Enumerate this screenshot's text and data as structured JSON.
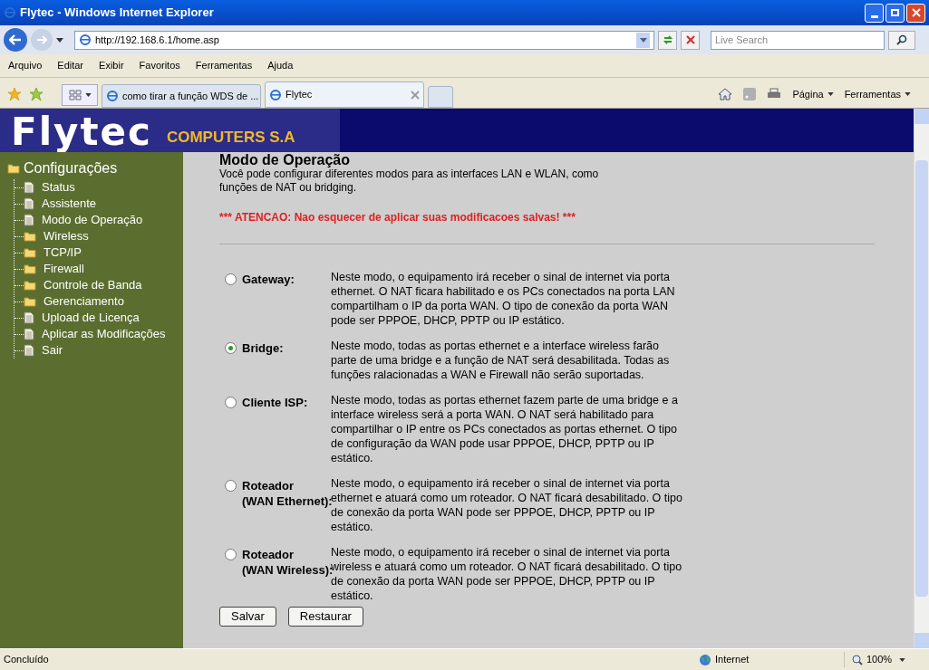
{
  "window": {
    "title": "Flytec - Windows Internet Explorer"
  },
  "address_bar": {
    "url": "http://192.168.6.1/home.asp"
  },
  "search": {
    "placeholder": "Live Search"
  },
  "menu": [
    "Arquivo",
    "Editar",
    "Exibir",
    "Favoritos",
    "Ferramentas",
    "Ajuda"
  ],
  "tabs": [
    {
      "label": "como tirar a função WDS de ...",
      "selected": false
    },
    {
      "label": "Flytec",
      "selected": true
    }
  ],
  "command_bar": [
    "Página",
    "Ferramentas"
  ],
  "header": {
    "logo": "Flytec",
    "subtitle": "COMPUTERS S.A"
  },
  "sidebar": {
    "root": "Configurações",
    "children": [
      {
        "label": "Status",
        "kind": "page"
      },
      {
        "label": "Assistente",
        "kind": "page"
      },
      {
        "label": "Modo de Operação",
        "kind": "page"
      },
      {
        "label": "Wireless",
        "kind": "folder"
      },
      {
        "label": "TCP/IP",
        "kind": "folder"
      },
      {
        "label": "Firewall",
        "kind": "folder"
      },
      {
        "label": "Controle de Banda",
        "kind": "folder"
      },
      {
        "label": "Gerenciamento",
        "kind": "folder"
      },
      {
        "label": "Upload de Licença",
        "kind": "page"
      },
      {
        "label": "Aplicar as Modificações",
        "kind": "page"
      },
      {
        "label": "Sair",
        "kind": "page"
      }
    ]
  },
  "content": {
    "title": "Modo de Operação",
    "intro": "Você pode configurar diferentes modos para as interfaces LAN e WLAN, como funções de NAT ou bridging.",
    "warning": "*** ATENCAO: Nao esquecer de aplicar suas modificacoes salvas! ***",
    "modes": [
      {
        "label": "Gateway:",
        "selected": false,
        "description": "Neste modo, o equipamento irá receber o sinal de internet via porta ethernet. O NAT ficara habilitado e os PCs conectados na porta LAN compartilham o IP da porta WAN. O tipo de conexão da porta WAN pode ser PPPOE, DHCP, PPTP ou IP estático."
      },
      {
        "label": "Bridge:",
        "selected": true,
        "description": "Neste modo, todas as portas ethernet e a interface wireless farão parte de uma bridge e a função de NAT será desabilitada. Todas as funções ralacionadas a WAN e Firewall não serão suportadas."
      },
      {
        "label": "Cliente ISP:",
        "selected": false,
        "description": "Neste modo, todas as portas ethernet fazem parte de uma bridge e a interface wireless será a porta WAN. O NAT será habilitado para compartilhar o IP entre os PCs conectados as portas ethernet. O tipo de configuração da WAN pode usar PPPOE, DHCP, PPTP ou IP estático."
      },
      {
        "label": "Roteador\n(WAN Ethernet):",
        "selected": false,
        "description": "Neste modo, o equipamento irá receber o sinal de internet via porta ethernet e atuará como um roteador. O NAT ficará desabilitado. O tipo de conexão da porta WAN pode ser PPPOE, DHCP, PPTP ou IP estático."
      },
      {
        "label": "Roteador\n(WAN Wireless):",
        "selected": false,
        "description": "Neste modo, o equipamento irá receber o sinal de internet via porta wireless e atuará como um roteador. O NAT ficará desabilitado. O tipo de conexão da porta WAN pode ser PPPOE, DHCP, PPTP ou IP estático."
      }
    ],
    "buttons": [
      "Salvar",
      "Restaurar"
    ]
  },
  "status_bar": {
    "text": "Concluído",
    "zone": "Internet",
    "zoom": "100%"
  }
}
